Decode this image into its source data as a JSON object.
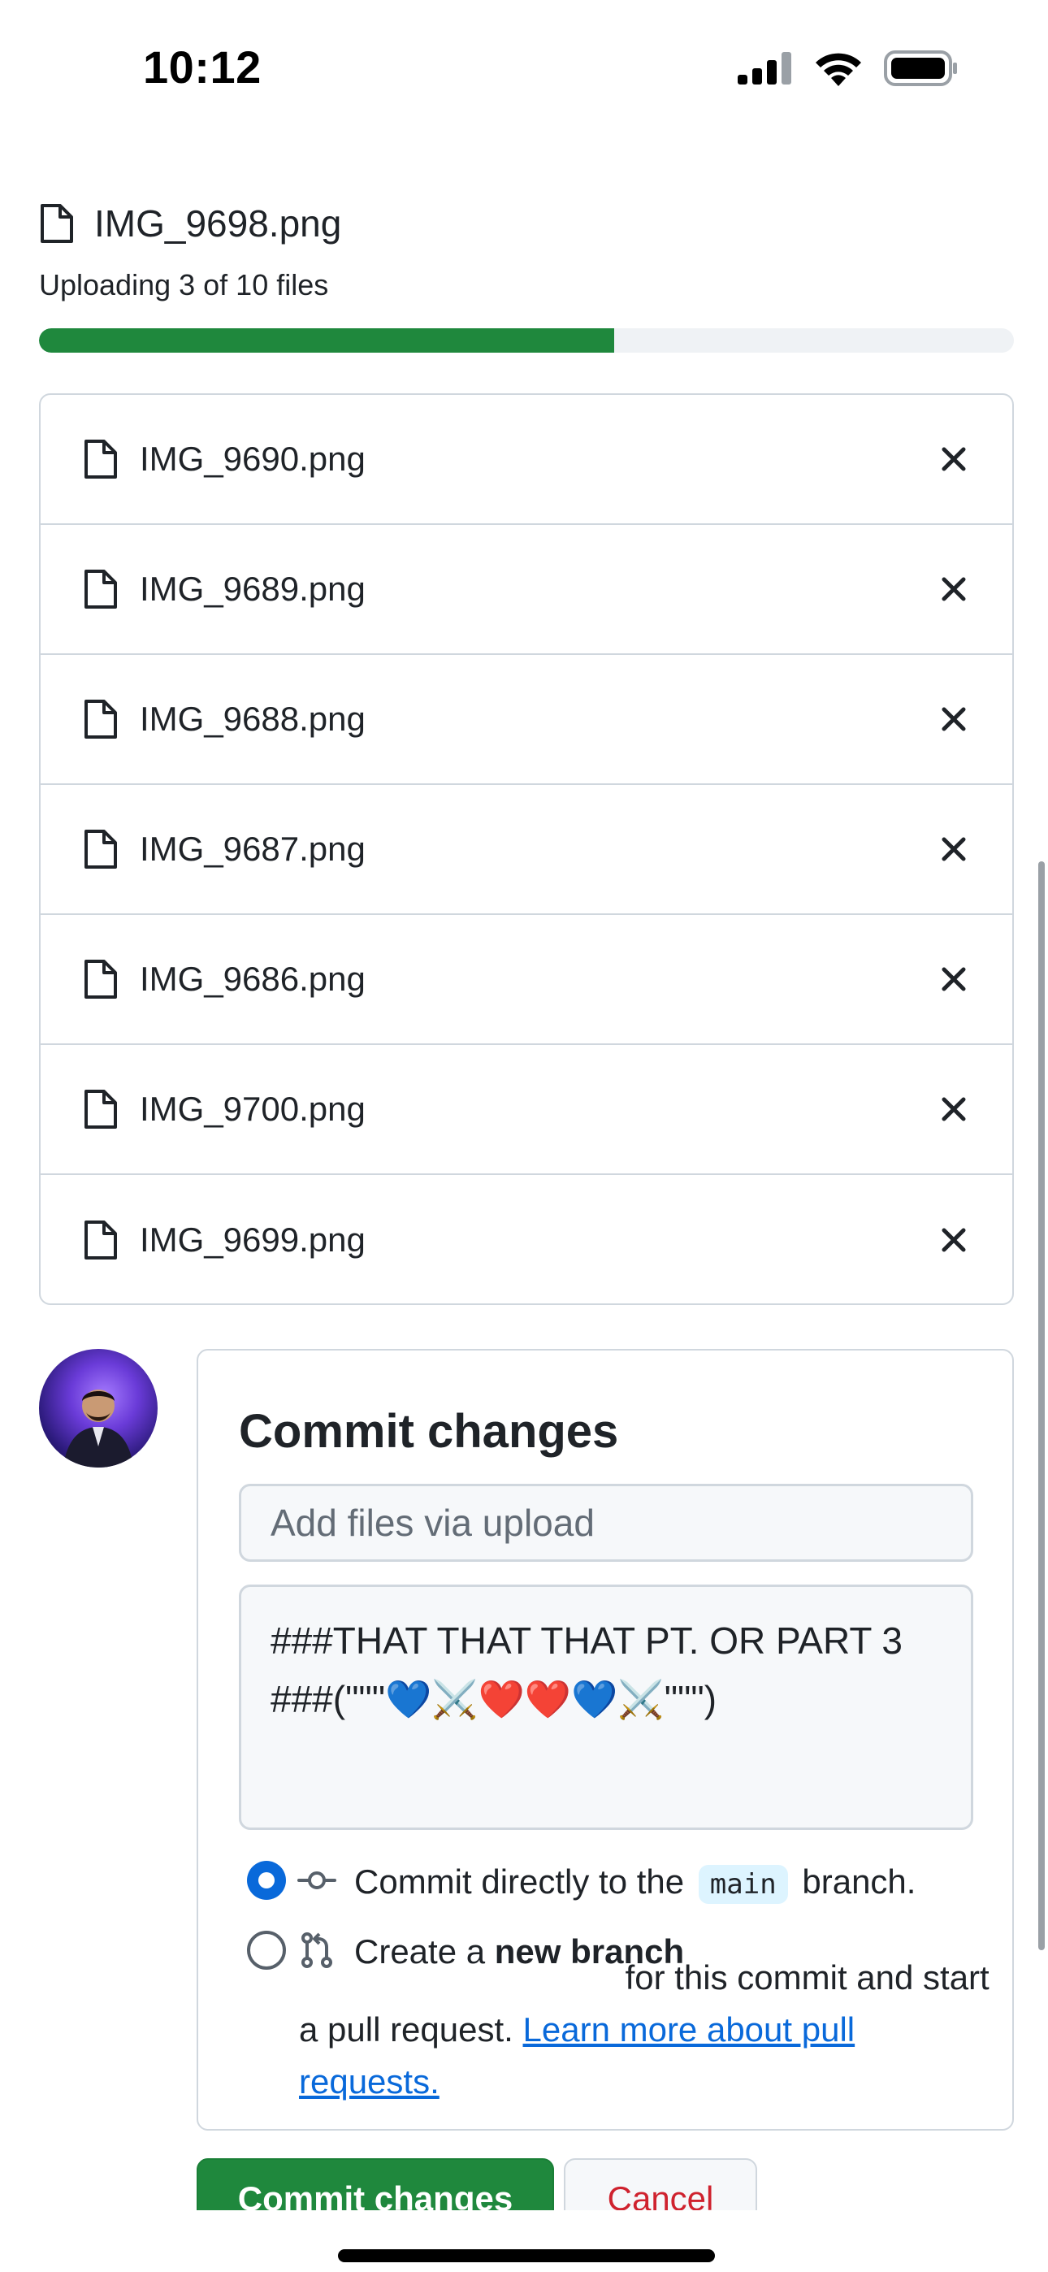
{
  "status_bar": {
    "time": "10:12"
  },
  "upload": {
    "current_file": "IMG_9698.png",
    "status_text": "Uploading 3 of 10 files",
    "progress_fraction": 0.59
  },
  "files": [
    {
      "name": "IMG_9690.png"
    },
    {
      "name": "IMG_9689.png"
    },
    {
      "name": "IMG_9688.png"
    },
    {
      "name": "IMG_9687.png"
    },
    {
      "name": "IMG_9686.png"
    },
    {
      "name": "IMG_9700.png"
    },
    {
      "name": "IMG_9699.png"
    }
  ],
  "commit": {
    "title": "Commit changes",
    "summary_placeholder": "Add files via upload",
    "description_value": "###THAT THAT THAT PT. OR PART 3 ###(\"\"\"💙⚔️❤️❤️💙⚔️\"\"\")",
    "option_direct": {
      "before": "Commit directly to the",
      "branch": "main",
      "after": "branch.",
      "selected": true
    },
    "option_new_branch": {
      "before": "Create a",
      "bold": "new branch",
      "after": "for this commit and start a pull request.",
      "link": "Learn more about pull requests.",
      "selected": false
    }
  },
  "buttons": {
    "commit_label": "Commit changes",
    "cancel_label": "Cancel"
  },
  "colors": {
    "progress": "#1f883d",
    "link": "#0969da",
    "cancel_text": "#cf222e",
    "radio_selected": "#0969da"
  }
}
